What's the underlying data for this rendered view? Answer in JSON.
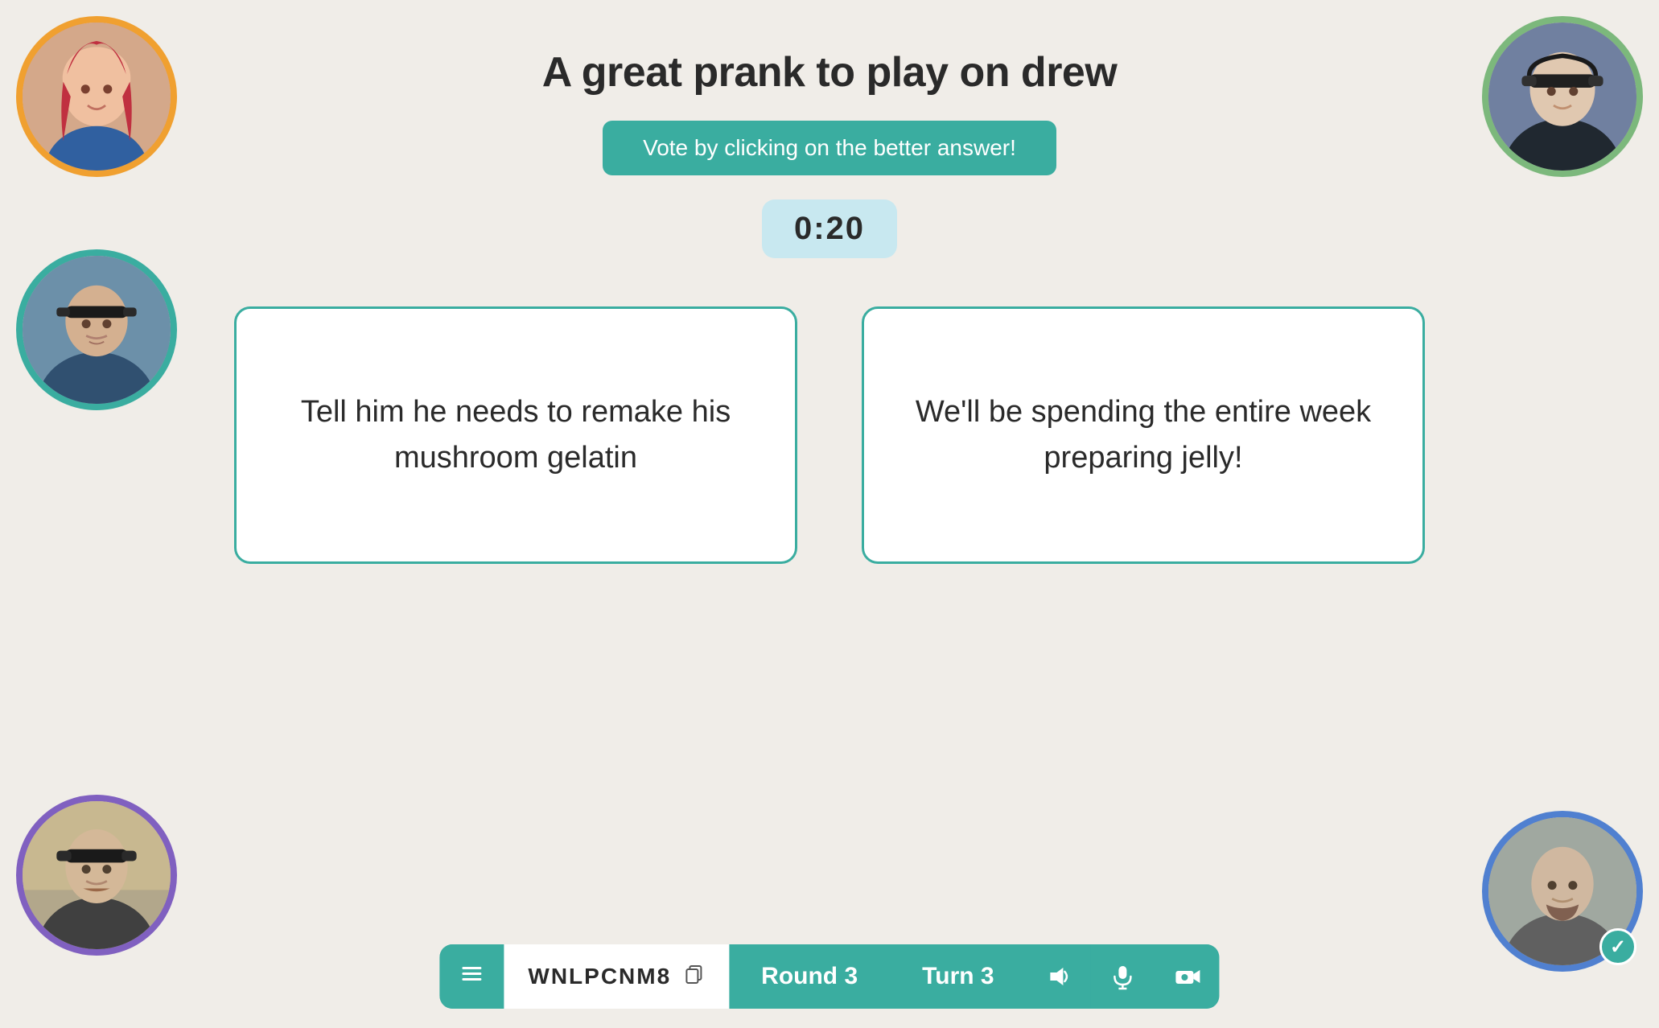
{
  "title": "A great prank to play on drew",
  "vote_banner": "Vote by clicking on the better answer!",
  "timer": "0:20",
  "answer_left": "Tell him he needs to remake his mushroom gelatin",
  "answer_right": "We'll be spending the entire week preparing jelly!",
  "game_code": "WNLPCNM8",
  "round_label": "Round 3",
  "turn_label": "Turn 3",
  "players": [
    {
      "id": "tl",
      "border_color": "#f0a030",
      "bg1": "#c8755a",
      "bg2": "#d89070"
    },
    {
      "id": "tr",
      "border_color": "#7cb87c",
      "bg1": "#7080a0",
      "bg2": "#505870"
    },
    {
      "id": "ml",
      "border_color": "#3aada0",
      "bg1": "#5080a0",
      "bg2": "#304858"
    },
    {
      "id": "bl",
      "border_color": "#8060c0",
      "bg1": "#b8a070",
      "bg2": "#806040"
    },
    {
      "id": "br",
      "border_color": "#5080d0",
      "bg1": "#909890",
      "bg2": "#707870"
    }
  ],
  "icons": {
    "list": "☰",
    "copy": "⧉",
    "volume": "🔊",
    "mic": "🎤",
    "camera": "📷",
    "check": "✓"
  }
}
